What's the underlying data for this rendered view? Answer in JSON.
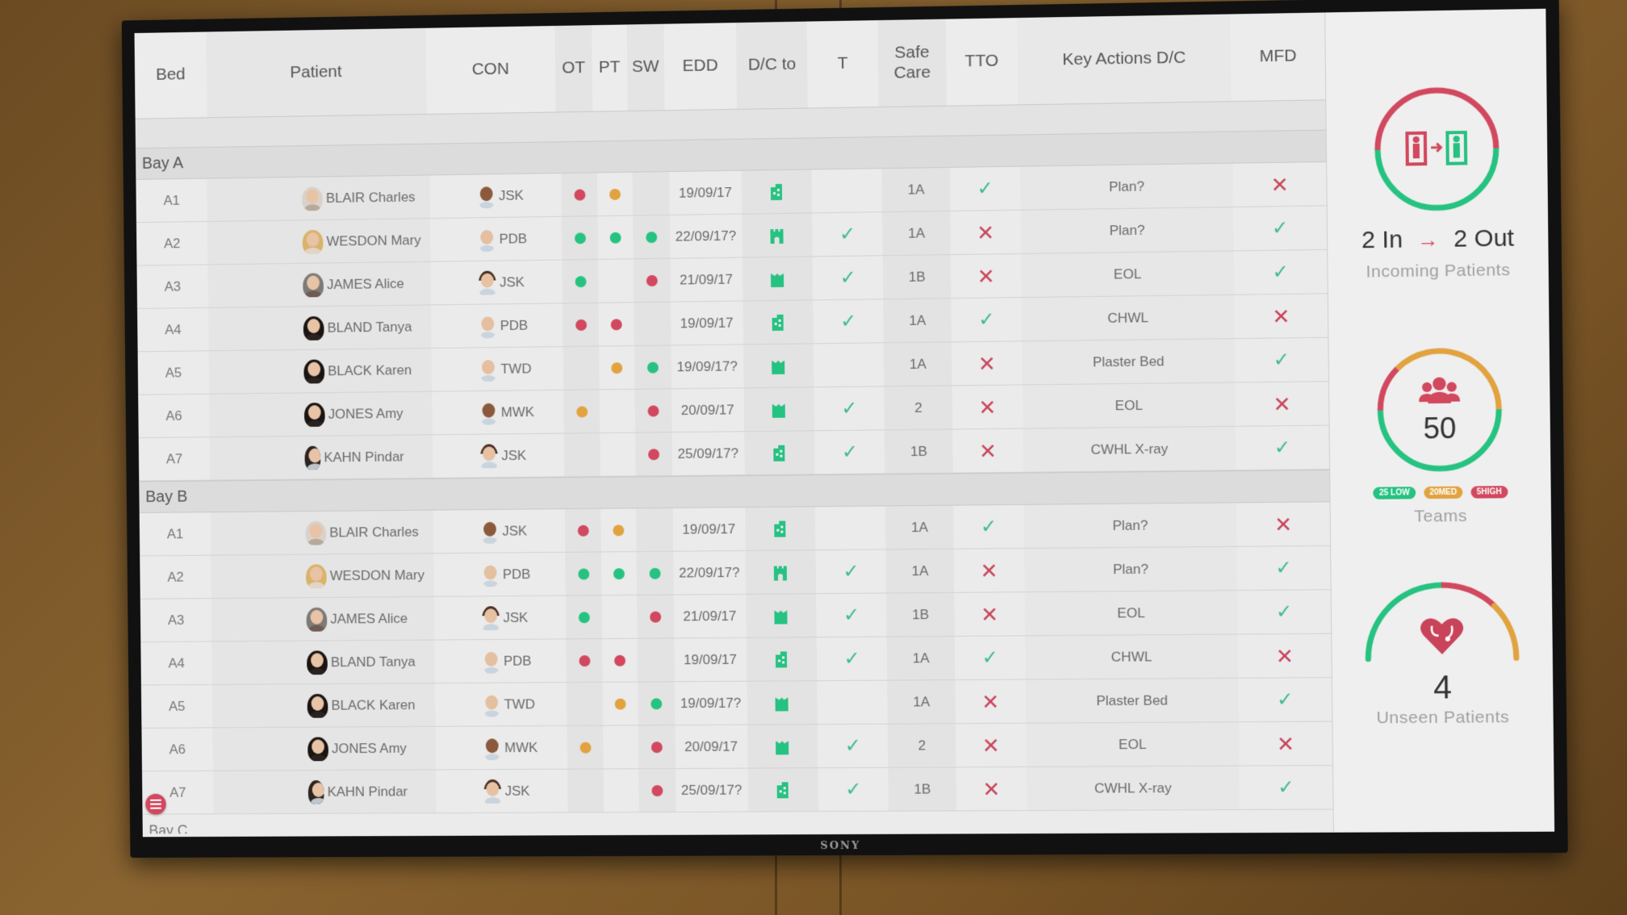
{
  "colors": {
    "red": "#d2485e",
    "amber": "#e1a33f",
    "green": "#26c281",
    "check": "#3dbb8e",
    "cross": "#c8445a"
  },
  "table": {
    "headers": {
      "bed": "Bed",
      "patient": "Patient",
      "con": "CON",
      "ot": "OT",
      "pt": "PT",
      "sw": "SW",
      "edd": "EDD",
      "dc_to": "D/C to",
      "t": "T",
      "safe_care": "Safe Care",
      "tto": "TTO",
      "key_actions": "Key Actions D/C",
      "mfd": "MFD"
    },
    "bays": [
      {
        "label": "Bay A",
        "rows": [
          {
            "bed": "A1",
            "patient": "BLAIR Charles",
            "avatar": "elder",
            "con": "JSK",
            "con_avatar": "doc",
            "ot": "red",
            "pt": "amber",
            "sw": "",
            "edd": "19/09/17",
            "dc_icon": "building-icon",
            "t": "",
            "safe_care": "1A",
            "tto": "check",
            "key_action": "Plan?",
            "mfd": "cross"
          },
          {
            "bed": "A2",
            "patient": "WESDON Mary",
            "avatar": "blonde",
            "con": "PDB",
            "con_avatar": "doc light",
            "ot": "green",
            "pt": "green",
            "sw": "green",
            "edd": "22/09/17?",
            "dc_icon": "castle-icon",
            "t": "check",
            "safe_care": "1A",
            "tto": "cross",
            "key_action": "Plan?",
            "mfd": "check"
          },
          {
            "bed": "A3",
            "patient": "JAMES Alice",
            "avatar": "grey",
            "con": "JSK",
            "con_avatar": "doc fem",
            "ot": "green",
            "pt": "",
            "sw": "red",
            "edd": "21/09/17",
            "dc_icon": "home-icon",
            "t": "check",
            "safe_care": "1B",
            "tto": "cross",
            "key_action": "EOL",
            "mfd": "check"
          },
          {
            "bed": "A4",
            "patient": "BLAND Tanya",
            "avatar": "dark",
            "con": "PDB",
            "con_avatar": "doc light",
            "ot": "red",
            "pt": "red",
            "sw": "",
            "edd": "19/09/17",
            "dc_icon": "building-icon",
            "t": "check",
            "safe_care": "1A",
            "tto": "check",
            "key_action": "CHWL",
            "mfd": "cross"
          },
          {
            "bed": "A5",
            "patient": "BLACK Karen",
            "avatar": "dark",
            "con": "TWD",
            "con_avatar": "doc light",
            "ot": "",
            "pt": "amber",
            "sw": "green",
            "edd": "19/09/17?",
            "dc_icon": "home-icon",
            "t": "",
            "safe_care": "1A",
            "tto": "cross",
            "key_action": "Plaster Bed",
            "mfd": "check"
          },
          {
            "bed": "A6",
            "patient": "JONES Amy",
            "avatar": "dark",
            "con": "MWK",
            "con_avatar": "doc",
            "ot": "amber",
            "pt": "",
            "sw": "red",
            "edd": "20/09/17",
            "dc_icon": "home-icon",
            "t": "check",
            "safe_care": "2",
            "tto": "cross",
            "key_action": "EOL",
            "mfd": "cross"
          },
          {
            "bed": "A7",
            "patient": "KAHN Pindar",
            "avatar": "man",
            "con": "JSK",
            "con_avatar": "doc fem",
            "ot": "",
            "pt": "",
            "sw": "red",
            "edd": "25/09/17?",
            "dc_icon": "building-icon",
            "t": "check",
            "safe_care": "1B",
            "tto": "cross",
            "key_action": "CWHL X-ray",
            "mfd": "check"
          }
        ]
      },
      {
        "label": "Bay B",
        "rows": [
          {
            "bed": "A1",
            "patient": "BLAIR Charles",
            "avatar": "elder",
            "con": "JSK",
            "con_avatar": "doc",
            "ot": "red",
            "pt": "amber",
            "sw": "",
            "edd": "19/09/17",
            "dc_icon": "building-icon",
            "t": "",
            "safe_care": "1A",
            "tto": "check",
            "key_action": "Plan?",
            "mfd": "cross"
          },
          {
            "bed": "A2",
            "patient": "WESDON Mary",
            "avatar": "blonde",
            "con": "PDB",
            "con_avatar": "doc light",
            "ot": "green",
            "pt": "green",
            "sw": "green",
            "edd": "22/09/17?",
            "dc_icon": "castle-icon",
            "t": "check",
            "safe_care": "1A",
            "tto": "cross",
            "key_action": "Plan?",
            "mfd": "check"
          },
          {
            "bed": "A3",
            "patient": "JAMES Alice",
            "avatar": "grey",
            "con": "JSK",
            "con_avatar": "doc fem",
            "ot": "green",
            "pt": "",
            "sw": "red",
            "edd": "21/09/17",
            "dc_icon": "home-icon",
            "t": "check",
            "safe_care": "1B",
            "tto": "cross",
            "key_action": "EOL",
            "mfd": "check"
          },
          {
            "bed": "A4",
            "patient": "BLAND Tanya",
            "avatar": "dark",
            "con": "PDB",
            "con_avatar": "doc light",
            "ot": "red",
            "pt": "red",
            "sw": "",
            "edd": "19/09/17",
            "dc_icon": "building-icon",
            "t": "check",
            "safe_care": "1A",
            "tto": "check",
            "key_action": "CHWL",
            "mfd": "cross"
          },
          {
            "bed": "A5",
            "patient": "BLACK Karen",
            "avatar": "dark",
            "con": "TWD",
            "con_avatar": "doc light",
            "ot": "",
            "pt": "amber",
            "sw": "green",
            "edd": "19/09/17?",
            "dc_icon": "home-icon",
            "t": "",
            "safe_care": "1A",
            "tto": "cross",
            "key_action": "Plaster Bed",
            "mfd": "check"
          },
          {
            "bed": "A6",
            "patient": "JONES Amy",
            "avatar": "dark",
            "con": "MWK",
            "con_avatar": "doc",
            "ot": "amber",
            "pt": "",
            "sw": "red",
            "edd": "20/09/17",
            "dc_icon": "home-icon",
            "t": "check",
            "safe_care": "2",
            "tto": "cross",
            "key_action": "EOL",
            "mfd": "cross"
          },
          {
            "bed": "A7",
            "patient": "KAHN Pindar",
            "avatar": "man",
            "con": "JSK",
            "con_avatar": "doc fem",
            "ot": "",
            "pt": "",
            "sw": "red",
            "edd": "25/09/17?",
            "dc_icon": "building-icon",
            "t": "check",
            "safe_care": "1B",
            "tto": "cross",
            "key_action": "CWHL X-ray",
            "mfd": "check"
          }
        ]
      }
    ],
    "next_bay_peek": "Bay C"
  },
  "sidebar": {
    "incoming": {
      "in_label": "2 In",
      "out_label": "2 Out",
      "arrow": "→",
      "caption": "Incoming Patients",
      "ring_split": {
        "red": 0.5,
        "green": 0.5
      }
    },
    "teams": {
      "count": "50",
      "caption": "Teams",
      "pills": [
        {
          "label": "25 LOW",
          "value": 25,
          "color": "#26c281"
        },
        {
          "label": "20MED",
          "value": 20,
          "color": "#e1a33f"
        },
        {
          "label": "5HIGH",
          "value": 5,
          "color": "#d2485e"
        }
      ]
    },
    "unseen": {
      "count": "4",
      "caption": "Unseen Patients"
    }
  },
  "tv_brand": "SONY"
}
